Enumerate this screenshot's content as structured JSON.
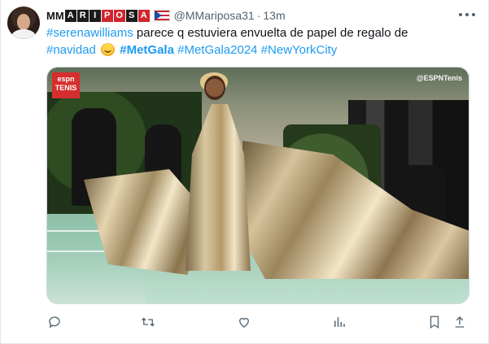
{
  "author": {
    "brand_text": "MM",
    "brand_tiles": [
      "A",
      "R",
      "I",
      "P",
      "O",
      "S",
      "A"
    ],
    "handle": "@MMariposa31",
    "separator": "·",
    "time": "13m"
  },
  "post": {
    "line1_tag": "#serenawilliams",
    "line1_text": " parece q estuviera envuelta de papel de regalo de",
    "tag_navidad": "#navidad",
    "tag_metgala": "#MetGala",
    "tag_metgala2024": "#MetGala2024",
    "tag_nyc": "#NewYorkCity"
  },
  "media": {
    "logo_line1": "espn",
    "logo_line2": "TENIS",
    "watermark": "@ESPNTenis"
  },
  "icons": {
    "reply": "reply-icon",
    "retweet": "retweet-icon",
    "like": "heart-icon",
    "views": "analytics-icon",
    "bookmark": "bookmark-icon",
    "share": "share-icon",
    "more": "more-icon"
  },
  "colors": {
    "accent": "#1d9bf0",
    "secondary_text": "#536471",
    "brand_red": "#d0262e"
  }
}
